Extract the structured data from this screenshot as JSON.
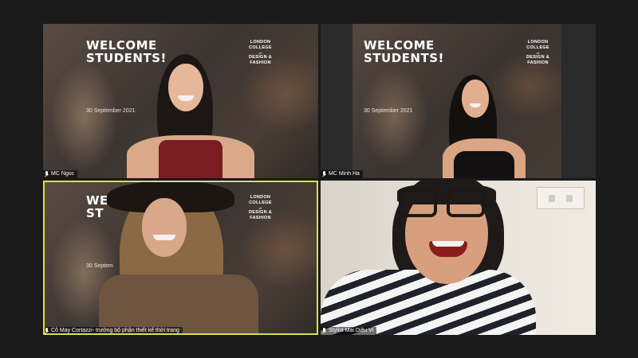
{
  "participants": [
    {
      "name": "MC Ngoc",
      "background": {
        "welcome_line1": "WELCOME",
        "welcome_line2": "STUDENTS!",
        "date": "30 September 2021",
        "college_line1": "LONDON",
        "college_line2": "COLLEGE",
        "college_line3": "of",
        "college_line4": "DESIGN &",
        "college_line5": "FASHION"
      },
      "mic_icon": "mic-muted-icon",
      "active_speaker": false
    },
    {
      "name": "MC Minh Ha",
      "background": {
        "welcome_line1": "WELCOME",
        "welcome_line2": "STUDENTS!",
        "date": "30 September 2021",
        "college_line1": "LONDON",
        "college_line2": "COLLEGE",
        "college_line3": "of",
        "college_line4": "DESIGN &",
        "college_line5": "FASHION"
      },
      "mic_icon": "mic-muted-icon",
      "active_speaker": false
    },
    {
      "name": "Cô May Cortazzi- trưởng bộ phận thiết kế thời trang",
      "background": {
        "welcome_line1": "WE",
        "welcome_line2": "ST",
        "date": "30 Septem",
        "college_line1": "LONDON",
        "college_line2": "COLLEGE",
        "college_line3": "of",
        "college_line4": "DESIGN &",
        "college_line5": "FASHION"
      },
      "mic_icon": "mic-muted-icon",
      "active_speaker": true
    },
    {
      "name": "Stylist Mai Diệu Vi",
      "mic_icon": "mic-muted-icon",
      "active_speaker": false
    }
  ],
  "colors": {
    "active_speaker_border": "#d8e24a",
    "page_background": "#1a1a1a"
  }
}
